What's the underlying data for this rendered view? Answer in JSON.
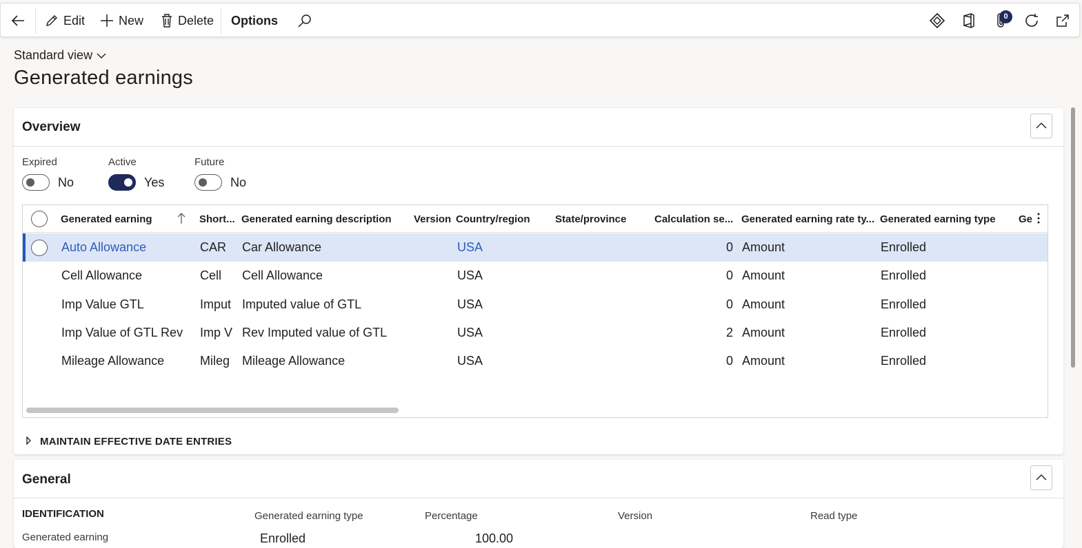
{
  "toolbar": {
    "edit_label": "Edit",
    "new_label": "New",
    "delete_label": "Delete",
    "options_label": "Options",
    "attachments_count": "0"
  },
  "view": {
    "label": "Standard view"
  },
  "page": {
    "title": "Generated earnings"
  },
  "overview": {
    "title": "Overview",
    "filters": [
      {
        "label": "Expired",
        "value": "No",
        "on": false
      },
      {
        "label": "Active",
        "value": "Yes",
        "on": true
      },
      {
        "label": "Future",
        "value": "No",
        "on": false
      }
    ],
    "columns": [
      "Generated earning",
      "Short...",
      "Generated earning description",
      "Version",
      "Country/region",
      "State/province",
      "Calculation se...",
      "Generated earning rate ty...",
      "Generated earning type",
      "Ge"
    ],
    "rows": [
      {
        "earning": "Auto Allowance",
        "short": "CAR",
        "description": "Car Allowance",
        "country": "USA",
        "calc_seq": "0",
        "rate_type": "Amount",
        "type": "Enrolled"
      },
      {
        "earning": "Cell Allowance",
        "short": "Cell",
        "description": "Cell Allowance",
        "country": "USA",
        "calc_seq": "0",
        "rate_type": "Amount",
        "type": "Enrolled"
      },
      {
        "earning": "Imp Value GTL",
        "short": "Imput",
        "description": "Imputed value of GTL",
        "country": "USA",
        "calc_seq": "0",
        "rate_type": "Amount",
        "type": "Enrolled"
      },
      {
        "earning": "Imp Value of GTL Rev",
        "short": "Imp V",
        "description": "Rev Imputed value of GTL",
        "country": "USA",
        "calc_seq": "2",
        "rate_type": "Amount",
        "type": "Enrolled"
      },
      {
        "earning": "Mileage Allowance",
        "short": "Mileg",
        "description": "Mileage Allowance",
        "country": "USA",
        "calc_seq": "0",
        "rate_type": "Amount",
        "type": "Enrolled"
      }
    ],
    "maintain_label": "MAINTAIN EFFECTIVE DATE ENTRIES"
  },
  "general": {
    "title": "General",
    "identification_label": "IDENTIFICATION",
    "generated_earning_label": "Generated earning",
    "type_label": "Generated earning type",
    "type_value": "Enrolled",
    "percentage_label": "Percentage",
    "percentage_value": "100.00",
    "version_label": "Version",
    "read_type_label": "Read type"
  }
}
